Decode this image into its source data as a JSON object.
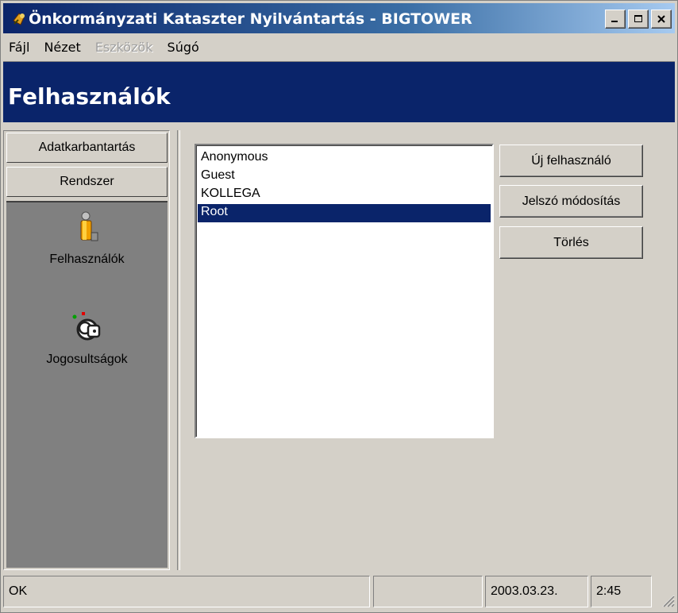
{
  "window": {
    "title": "Önkormányzati Kataszter Nyilvántartás - BIGTOWER"
  },
  "menu": {
    "items": [
      {
        "label": "Fájl",
        "enabled": true
      },
      {
        "label": "Nézet",
        "enabled": true
      },
      {
        "label": "Eszközök",
        "enabled": false
      },
      {
        "label": "Súgó",
        "enabled": true
      }
    ]
  },
  "header": {
    "title": "Felhasználók"
  },
  "sidebar": {
    "buttons": [
      "Adatkarbantartás",
      "Rendszer"
    ],
    "entries": [
      {
        "label": "Felhasználók",
        "icon": "user-icon"
      },
      {
        "label": "Jogosultságok",
        "icon": "key-icon"
      }
    ]
  },
  "users": {
    "items": [
      "Anonymous",
      "Guest",
      "KOLLEGA",
      "Root"
    ],
    "selected": "Root"
  },
  "actions": {
    "new_user": "Új felhasználó",
    "change_password": "Jelszó módosítás",
    "delete": "Törlés"
  },
  "status": {
    "message": "OK",
    "panel2": "",
    "date": "2003.03.23.",
    "time": "2:45"
  },
  "colors": {
    "titlebar": "#0a246a",
    "header": "#0a246a",
    "selection": "#0a246a",
    "face": "#d4d0c8"
  }
}
